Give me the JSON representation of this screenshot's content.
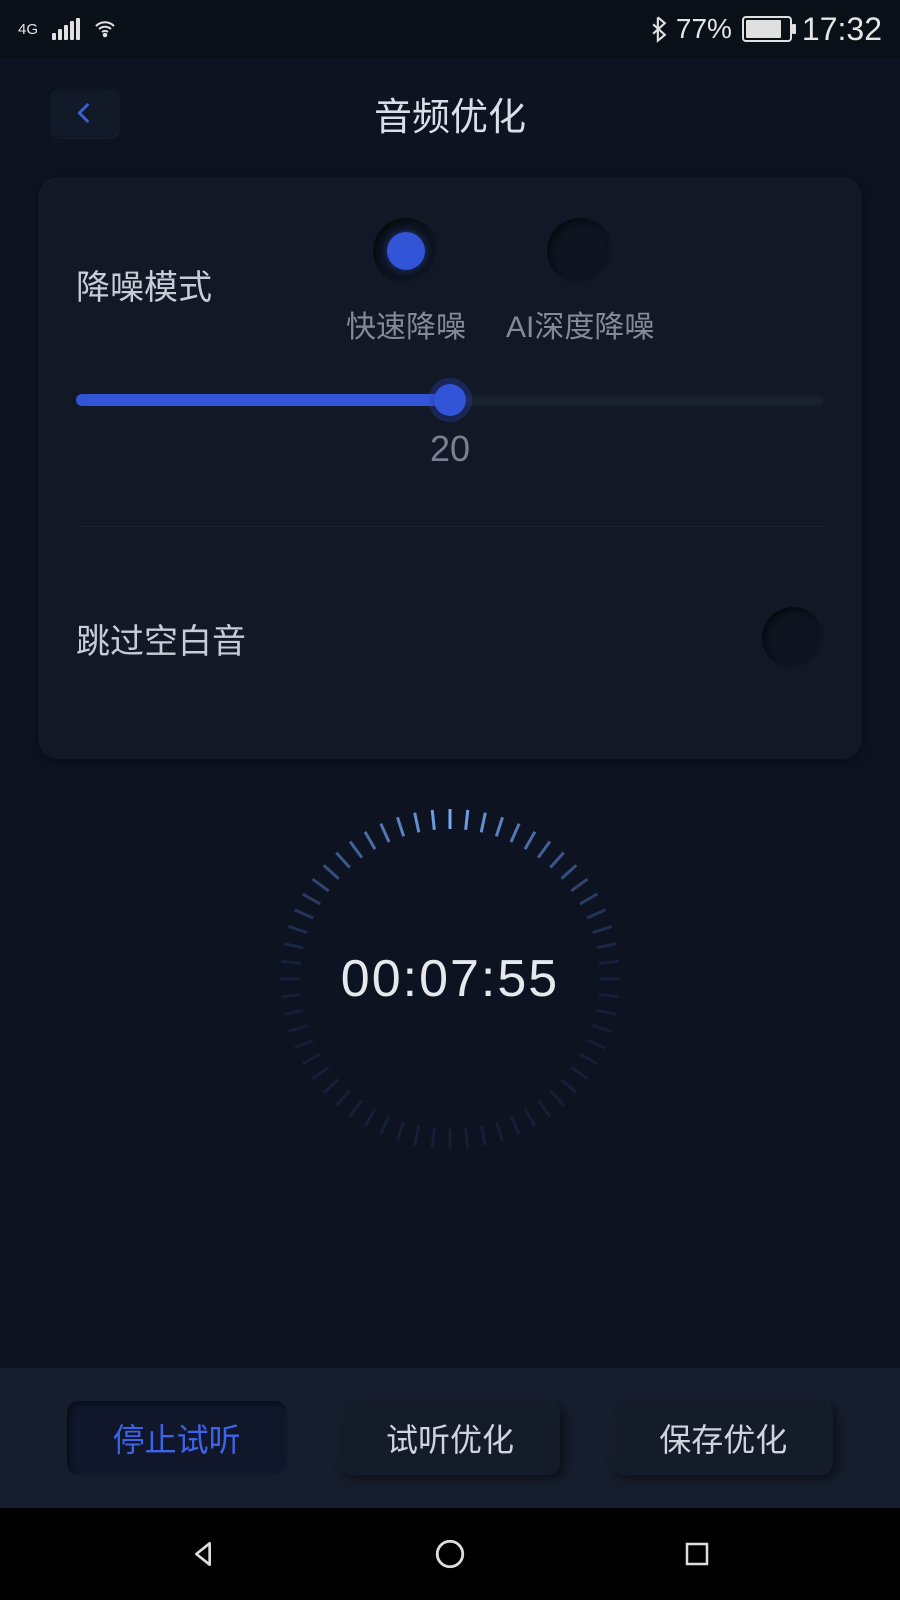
{
  "status": {
    "network": "4G",
    "battery_pct": "77%",
    "time": "17:32"
  },
  "header": {
    "title": "音频优化"
  },
  "noise": {
    "label": "降噪模式",
    "options": {
      "fast": "快速降噪",
      "ai_deep": "AI深度降噪"
    },
    "slider_value": "20",
    "slider_percent": 50
  },
  "skip_silence": {
    "label": "跳过空白音"
  },
  "timer": {
    "display": "00:07:55"
  },
  "buttons": {
    "stop_preview": "停止试听",
    "preview_optimize": "试听优化",
    "save_optimize": "保存优化"
  }
}
